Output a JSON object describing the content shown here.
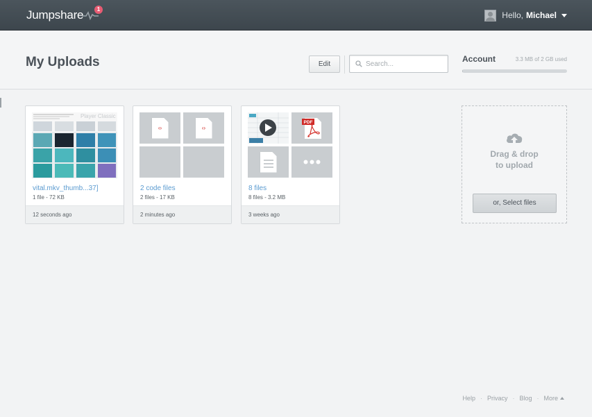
{
  "topbar": {
    "logo": "Jumpshare",
    "notification_count": "1",
    "greeting": "Hello,",
    "user_name": "Michael"
  },
  "header": {
    "title": "My Uploads",
    "edit_label": "Edit",
    "search_placeholder": "Search...",
    "account_label": "Account",
    "usage_text": "3.3 MB of 2 GB used",
    "usage_fraction": 0.0016
  },
  "cards": [
    {
      "title": "vital.mkv_thumb...37]",
      "meta": "1 file - 72 KB",
      "time": "12 seconds ago",
      "thumb_caption": "Player Classic"
    },
    {
      "title": "2 code files",
      "meta": "2 files - 17 KB",
      "time": "2 minutes ago"
    },
    {
      "title": "8 files",
      "meta": "8 files - 3.2 MB",
      "time": "3 weeks ago",
      "pdf_badge": "PDF"
    }
  ],
  "upload": {
    "line1": "Drag & drop",
    "line2": "to upload",
    "select_label": "or, Select files"
  },
  "footer": {
    "help": "Help",
    "privacy": "Privacy",
    "blog": "Blog",
    "more": "More"
  },
  "colors": {
    "topbar": "#434c53",
    "link": "#5b9bd0",
    "notification": "#e85c73"
  }
}
